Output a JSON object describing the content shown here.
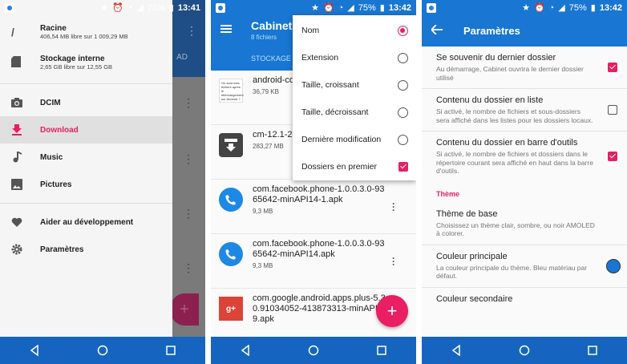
{
  "status": {
    "p1_battery": "75%",
    "p1_time": "13:41",
    "p2_battery": "75%",
    "p2_time": "13:42",
    "p3_battery": "75%",
    "p3_time": "13:42"
  },
  "drawer": {
    "storage": [
      {
        "icon": "slash-icon",
        "title": "Racine",
        "sub": "406,54 MB libre sur 1 009,29 MB"
      },
      {
        "icon": "sd-card-icon",
        "title": "Stockage interne",
        "sub": "2,65 GB libre sur 12,55 GB"
      }
    ],
    "folders": [
      {
        "icon": "camera-icon",
        "label": "DCIM"
      },
      {
        "icon": "download-icon",
        "label": "Download"
      },
      {
        "icon": "music-icon",
        "label": "Music"
      },
      {
        "icon": "image-icon",
        "label": "Pictures"
      }
    ],
    "extras": [
      {
        "icon": "heart-icon",
        "label": "Aider au développement"
      },
      {
        "icon": "gear-icon",
        "label": "Paramètres"
      }
    ],
    "bg_tab": "AD"
  },
  "list": {
    "title": "Cabinet",
    "subtitle": "8 fichiers",
    "tab": "STOCKAGE",
    "files": [
      {
        "name": "android-co fichiers-tel android.pr",
        "size": "36,79 KB",
        "thumb": "doc",
        "thumb_text": "Où sont mes fichiers après le téléchargement sur Android ?"
      },
      {
        "name": "cm-12.1-2 hammerhe",
        "size": "283,27 MB",
        "thumb": "archive"
      },
      {
        "name": "com.facebook.phone-1.0.0.3.0-9365642-minAPI14-1.apk",
        "size": "9,3 MB",
        "thumb": "phone"
      },
      {
        "name": "com.facebook.phone-1.0.0.3.0-9365642-minAPI14.apk",
        "size": "9,3 MB",
        "thumb": "phone"
      },
      {
        "name": "com.google.android.apps.plus-5.3.0.91034052-413873313-minAPI19.apk",
        "size": "",
        "thumb": "gplus",
        "thumb_text": "g+"
      }
    ],
    "fab": "+"
  },
  "sort_menu": {
    "options": [
      {
        "label": "Nom",
        "control": "radio",
        "checked": true
      },
      {
        "label": "Extension",
        "control": "radio",
        "checked": false
      },
      {
        "label": "Taille, croissant",
        "control": "radio",
        "checked": false
      },
      {
        "label": "Taille, décroissant",
        "control": "radio",
        "checked": false
      },
      {
        "label": "Dernière modification",
        "control": "radio",
        "checked": false
      },
      {
        "label": "Dossiers en premier",
        "control": "checkbox",
        "checked": true
      }
    ]
  },
  "settings": {
    "title": "Paramètres",
    "items": [
      {
        "title": "Se souvenir du dernier dossier",
        "desc": "Au démarrage, Cabinet ouvrira le dernier dossier utilisé",
        "control": "checkbox",
        "checked": true
      },
      {
        "title": "Contenu du dossier en liste",
        "desc": "Si activé, le nombre de fichiers et sous-dossiers sera affiché dans les listes pour les dossiers locaux.",
        "control": "checkbox",
        "checked": false
      },
      {
        "title": "Contenu du dossier en barre d'outils",
        "desc": "Si activé, le nombre de fichiers et dossiers dans le répertoire courant sera affiché en haut dans la barre d'outils.",
        "control": "checkbox",
        "checked": true
      }
    ],
    "section": "Thème",
    "theme_items": [
      {
        "title": "Thème de base",
        "desc": "Choisissez un thème clair, sombre, ou noir AMOLED à colorer.",
        "control": "none"
      },
      {
        "title": "Couleur principale",
        "desc": "La couleur principale du thème. Bleu matériau par défaut.",
        "control": "color",
        "color": "#1976d2"
      },
      {
        "title": "Couleur secondaire",
        "desc": "",
        "control": "none"
      }
    ]
  },
  "colors": {
    "primary": "#1976d2",
    "accent": "#e91e63",
    "navbar": "#1565c0"
  }
}
